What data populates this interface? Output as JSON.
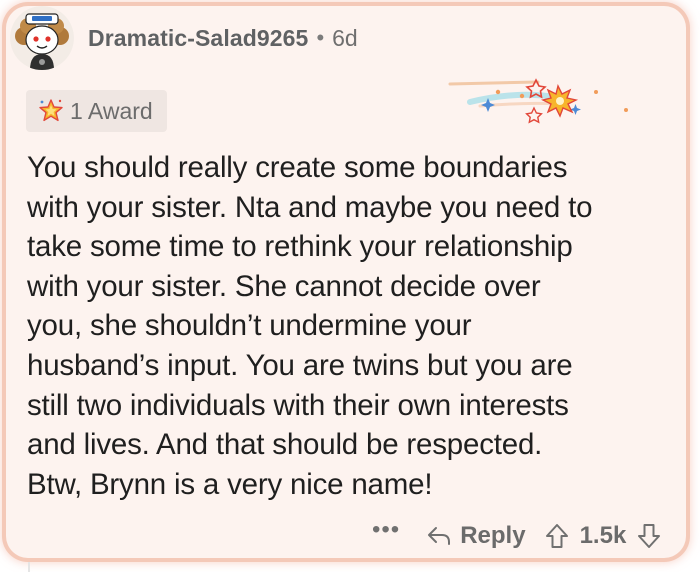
{
  "comment": {
    "author": "Dramatic-Salad9265",
    "separator": "•",
    "age": "6d",
    "avatar_icon": "snoo-avatar-icon",
    "awards": {
      "label": "1 Award",
      "icon": "star-award-icon"
    },
    "body": "You should really create some boundaries\nwith your sister. Nta and maybe you need to\ntake some time to rethink your relationship\nwith your sister. She cannot decide over\nyou, she shouldn’t undermine your\nhusband’s input. You are twins but you are\nstill two individuals with their own interests\nand lives. And that should be respected.\nBtw, Brynn is a very nice name!",
    "actions": {
      "more": "•••",
      "reply": "Reply",
      "score": "1.5k"
    }
  },
  "colors": {
    "card_background": "#fdf3ef",
    "card_glow": "#f4c9b8",
    "award_chip": "#efe6e2",
    "meta_text": "#5f6163",
    "body_text": "#1f1f1f"
  }
}
